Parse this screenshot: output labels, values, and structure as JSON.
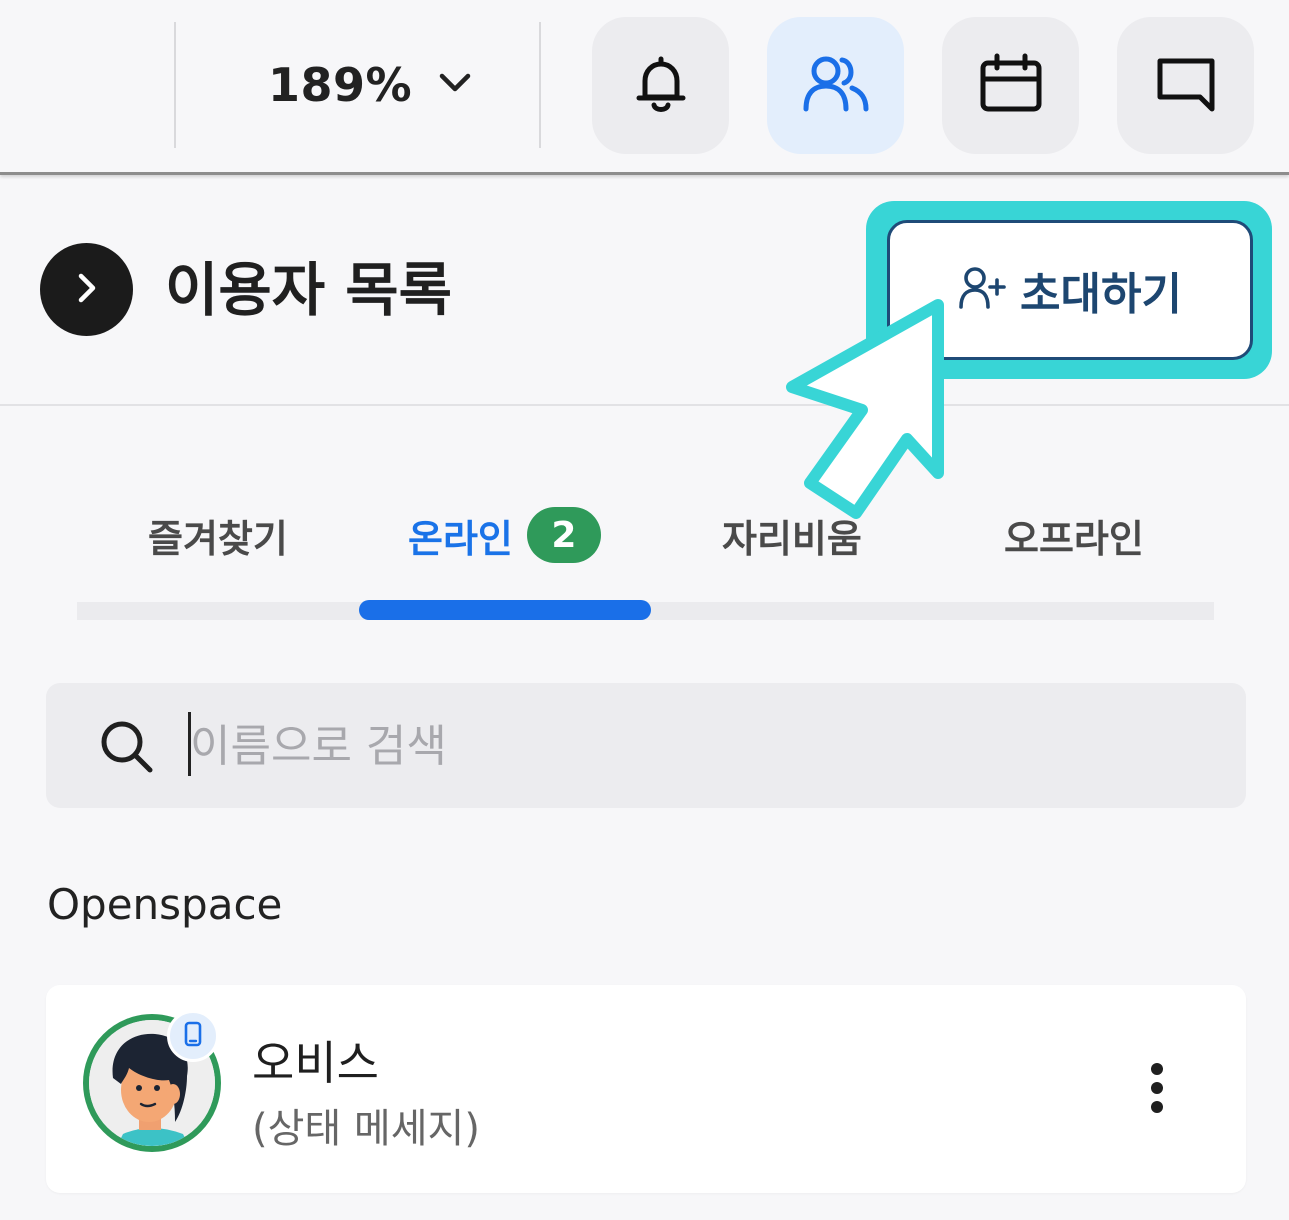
{
  "toolbar": {
    "zoom_value": "189%",
    "buttons": [
      {
        "icon": "bell-icon",
        "active": false
      },
      {
        "icon": "users-icon",
        "active": true
      },
      {
        "icon": "calendar-icon",
        "active": false
      },
      {
        "icon": "chat-icon",
        "active": false
      }
    ]
  },
  "header": {
    "title": "이용자 목록",
    "invite_label": "초대하기"
  },
  "tabs": [
    {
      "label": "즐겨찾기",
      "active": false
    },
    {
      "label": "온라인",
      "badge": "2",
      "active": true
    },
    {
      "label": "자리비움",
      "active": false
    },
    {
      "label": "오프라인",
      "active": false
    }
  ],
  "search": {
    "placeholder": "이름으로 검색",
    "value": ""
  },
  "group": {
    "label": "Openspace",
    "users": [
      {
        "name": "오비스",
        "status": "(상태 메세지)",
        "device": "mobile-icon",
        "online": true
      }
    ]
  },
  "colors": {
    "accent": "#1a6fe8",
    "online_badge": "#2f9a5a",
    "highlight": "#38d5d6",
    "invite_text": "#1d4670"
  }
}
